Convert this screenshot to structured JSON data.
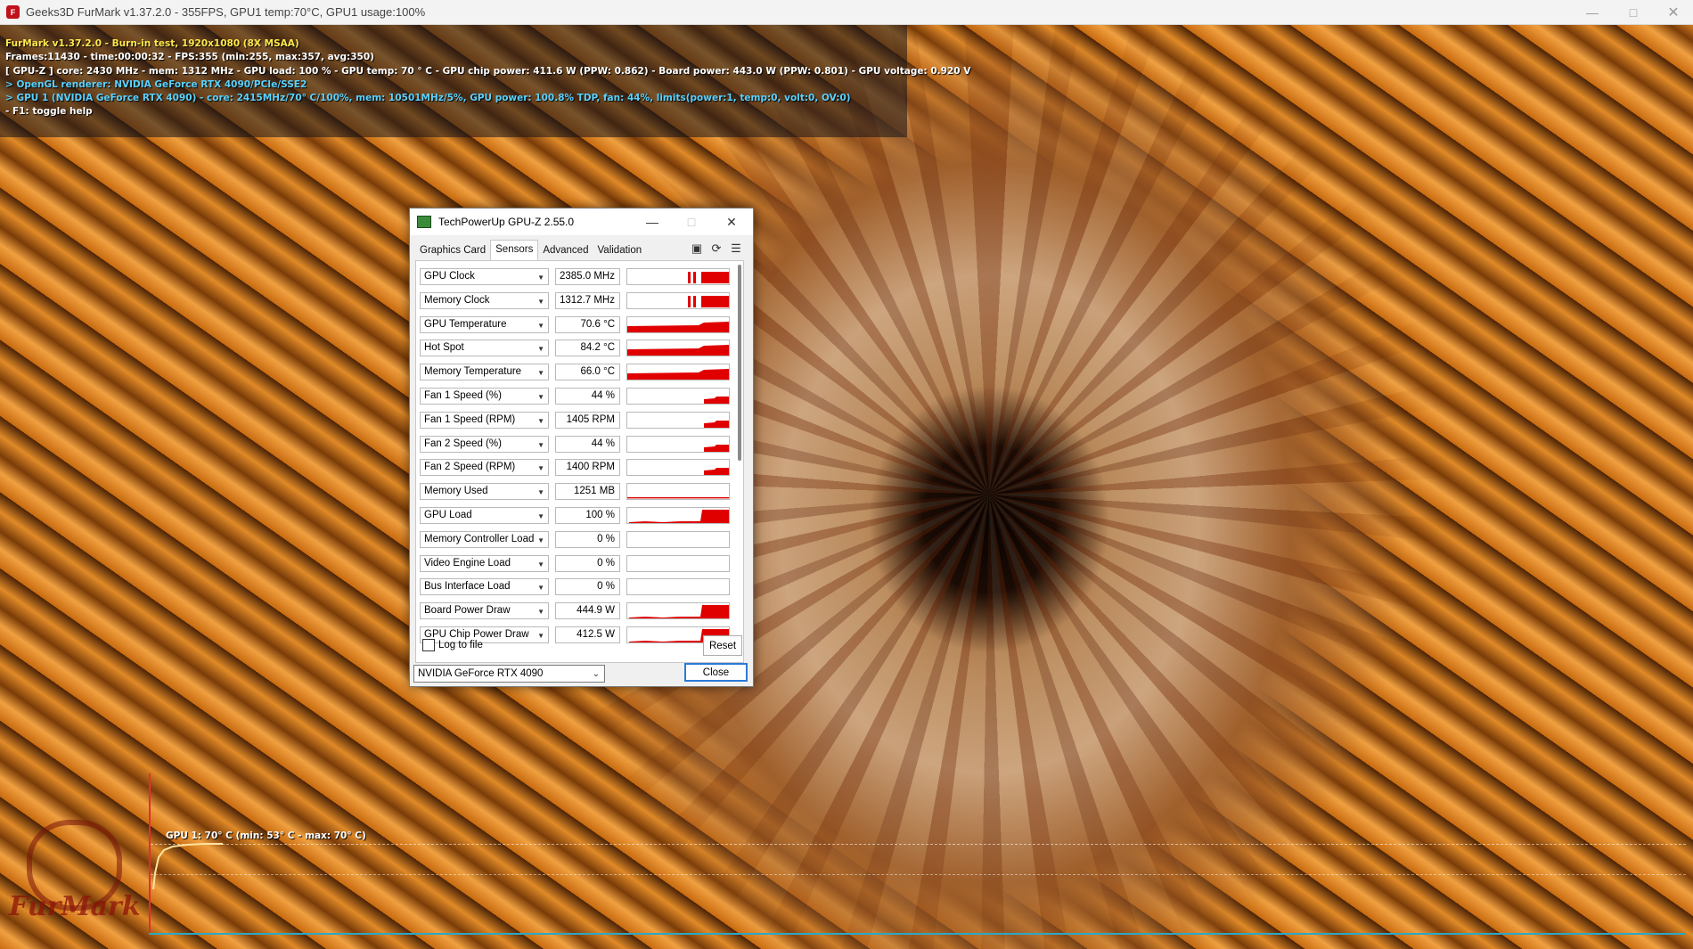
{
  "window": {
    "title": "Geeks3D FurMark v1.37.2.0 - 355FPS, GPU1 temp:70°C, GPU1 usage:100%"
  },
  "hud": {
    "lines": [
      {
        "text": "FurMark v1.37.2.0 - Burn-in test, 1920x1080 (8X MSAA)",
        "color": "#ffe94a"
      },
      {
        "text": "Frames:11430 - time:00:00:32 - FPS:355 (min:255, max:357, avg:350)",
        "color": "#ffffff"
      },
      {
        "text": "[ GPU-Z ] core: 2430 MHz - mem: 1312 MHz - GPU load: 100 % - GPU temp: 70 ° C - GPU chip power: 411.6 W (PPW: 0.862) - Board power: 443.0 W (PPW: 0.801) - GPU voltage: 0.920 V",
        "color": "#ffffff"
      },
      {
        "text": "> OpenGL renderer: NVIDIA GeForce RTX 4090/PCIe/SSE2",
        "color": "#5ad2ff"
      },
      {
        "text": "> GPU 1 (NVIDIA GeForce RTX 4090) - core: 2415MHz/70° C/100%, mem: 10501MHz/5%, GPU power: 100.8% TDP, fan: 44%, limits(power:1, temp:0, volt:0, OV:0)",
        "color": "#5ad2ff"
      },
      {
        "text": "- F1: toggle help",
        "color": "#ffffff"
      }
    ]
  },
  "graph": {
    "label": "GPU 1: 70° C (min: 53° C - max: 70° C)",
    "line_color": "#ffe3a0"
  },
  "logo": {
    "text": "FurMark"
  },
  "gpuz": {
    "title": "TechPowerUp GPU-Z 2.55.0",
    "tabs": [
      "Graphics Card",
      "Sensors",
      "Advanced",
      "Validation"
    ],
    "active_tab": "Sensors",
    "sensors": [
      {
        "name": "GPU Clock",
        "value": "2385.0 MHz",
        "graph": "clock"
      },
      {
        "name": "Memory Clock",
        "value": "1312.7 MHz",
        "graph": "clock"
      },
      {
        "name": "GPU Temperature",
        "value": "70.6 °C",
        "graph": "temp"
      },
      {
        "name": "Hot Spot",
        "value": "84.2 °C",
        "graph": "temp"
      },
      {
        "name": "Memory Temperature",
        "value": "66.0 °C",
        "graph": "temp"
      },
      {
        "name": "Fan 1 Speed (%)",
        "value": "44 %",
        "graph": "fan"
      },
      {
        "name": "Fan 1 Speed (RPM)",
        "value": "1405 RPM",
        "graph": "fan"
      },
      {
        "name": "Fan 2 Speed (%)",
        "value": "44 %",
        "graph": "fan"
      },
      {
        "name": "Fan 2 Speed (RPM)",
        "value": "1400 RPM",
        "graph": "fan"
      },
      {
        "name": "Memory Used",
        "value": "1251 MB",
        "graph": "line"
      },
      {
        "name": "GPU Load",
        "value": "100 %",
        "graph": "load"
      },
      {
        "name": "Memory Controller Load",
        "value": "0 %",
        "graph": "empty"
      },
      {
        "name": "Video Engine Load",
        "value": "0 %",
        "graph": "empty"
      },
      {
        "name": "Bus Interface Load",
        "value": "0 %",
        "graph": "empty"
      },
      {
        "name": "Board Power Draw",
        "value": "444.9 W",
        "graph": "load"
      },
      {
        "name": "GPU Chip Power Draw",
        "value": "412.5 W",
        "graph": "load"
      }
    ],
    "log_to_file": "Log to file",
    "reset": "Reset",
    "device": "NVIDIA GeForce RTX 4090",
    "close": "Close",
    "accent": "#e00000"
  }
}
